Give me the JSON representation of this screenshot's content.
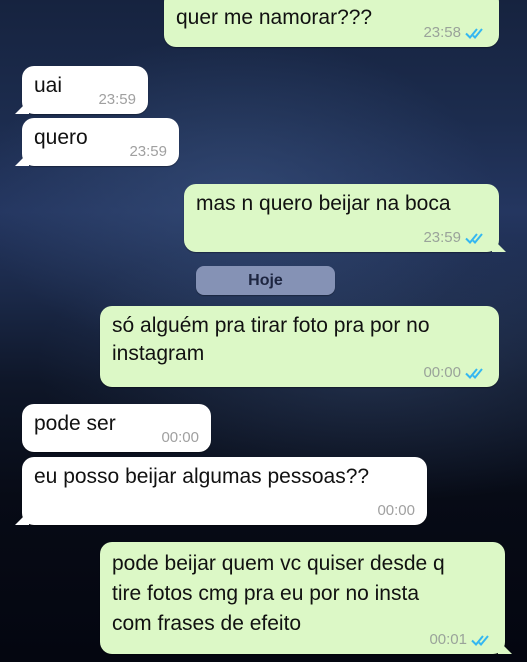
{
  "date_separator": "Hoje",
  "messages": [
    {
      "direction": "out",
      "text": "quer me namorar???",
      "time": "23:58",
      "status": "read"
    },
    {
      "direction": "in",
      "text": "uai",
      "time": "23:59"
    },
    {
      "direction": "in",
      "text": "quero",
      "time": "23:59"
    },
    {
      "direction": "out",
      "text": "mas n quero beijar na boca",
      "time": "23:59",
      "status": "read"
    },
    {
      "direction": "out",
      "text": "só alguém pra tirar foto pra por no\ninstagram",
      "time": "00:00",
      "status": "read"
    },
    {
      "direction": "in",
      "text": "pode ser",
      "time": "00:00"
    },
    {
      "direction": "in",
      "text": "eu posso beijar algumas pessoas??",
      "time": "00:00"
    },
    {
      "direction": "out",
      "text": "pode beijar quem vc quiser desde q\ntire fotos cmg pra eu por no insta\ncom frases de efeito",
      "time": "00:01",
      "status": "read"
    }
  ],
  "colors": {
    "outgoing_bubble": "#dcf8c6",
    "incoming_bubble": "#ffffff",
    "read_ticks": "#34b7f1",
    "date_pill": "#8592b5"
  },
  "icons": {
    "read_status": "double-check-icon"
  }
}
